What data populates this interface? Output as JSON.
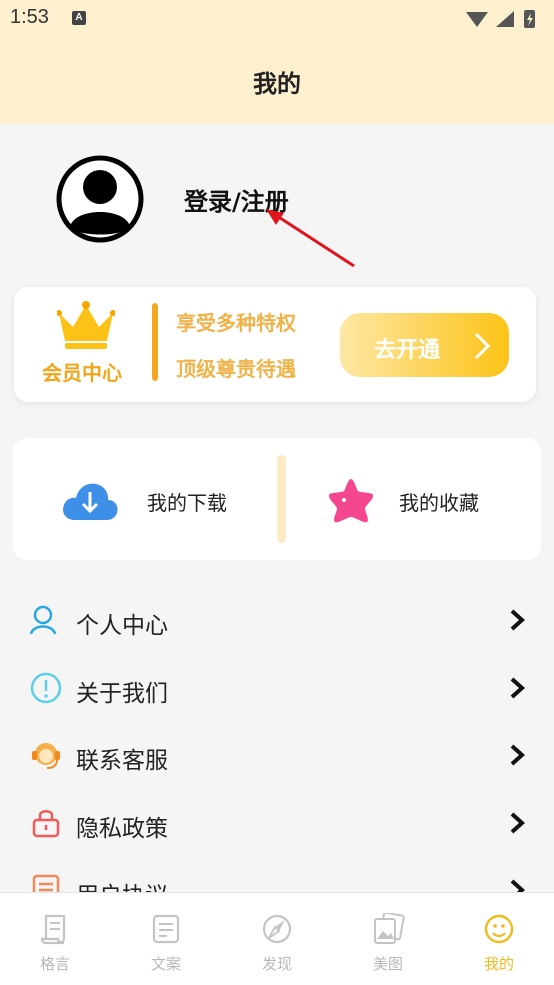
{
  "status_bar": {
    "time": "1:53",
    "notification_icon": "A"
  },
  "header": {
    "title": "我的"
  },
  "profile": {
    "login_text": "登录/注册"
  },
  "vip": {
    "title": "会员中心",
    "line1": "享受多种特权",
    "line2": "顶级尊贵待遇",
    "button_label": "去开通"
  },
  "quick_actions": {
    "download_label": "我的下载",
    "favorites_label": "我的收藏"
  },
  "menu": [
    {
      "label": "个人中心",
      "icon": "user-icon"
    },
    {
      "label": "关于我们",
      "icon": "info-icon"
    },
    {
      "label": "联系客服",
      "icon": "customer-service-icon"
    },
    {
      "label": "隐私政策",
      "icon": "lock-icon"
    },
    {
      "label": "用户协议",
      "icon": "document-icon"
    }
  ],
  "tabs": [
    {
      "label": "格言",
      "icon": "scroll-icon",
      "active": false
    },
    {
      "label": "文案",
      "icon": "note-icon",
      "active": false
    },
    {
      "label": "发现",
      "icon": "compass-icon",
      "active": false
    },
    {
      "label": "美图",
      "icon": "picture-icon",
      "active": false
    },
    {
      "label": "我的",
      "icon": "smile-icon",
      "active": true
    }
  ],
  "colors": {
    "header_bg": "#fdf0cf",
    "accent": "#f2b91c",
    "vip_text": "#f0b34a"
  }
}
